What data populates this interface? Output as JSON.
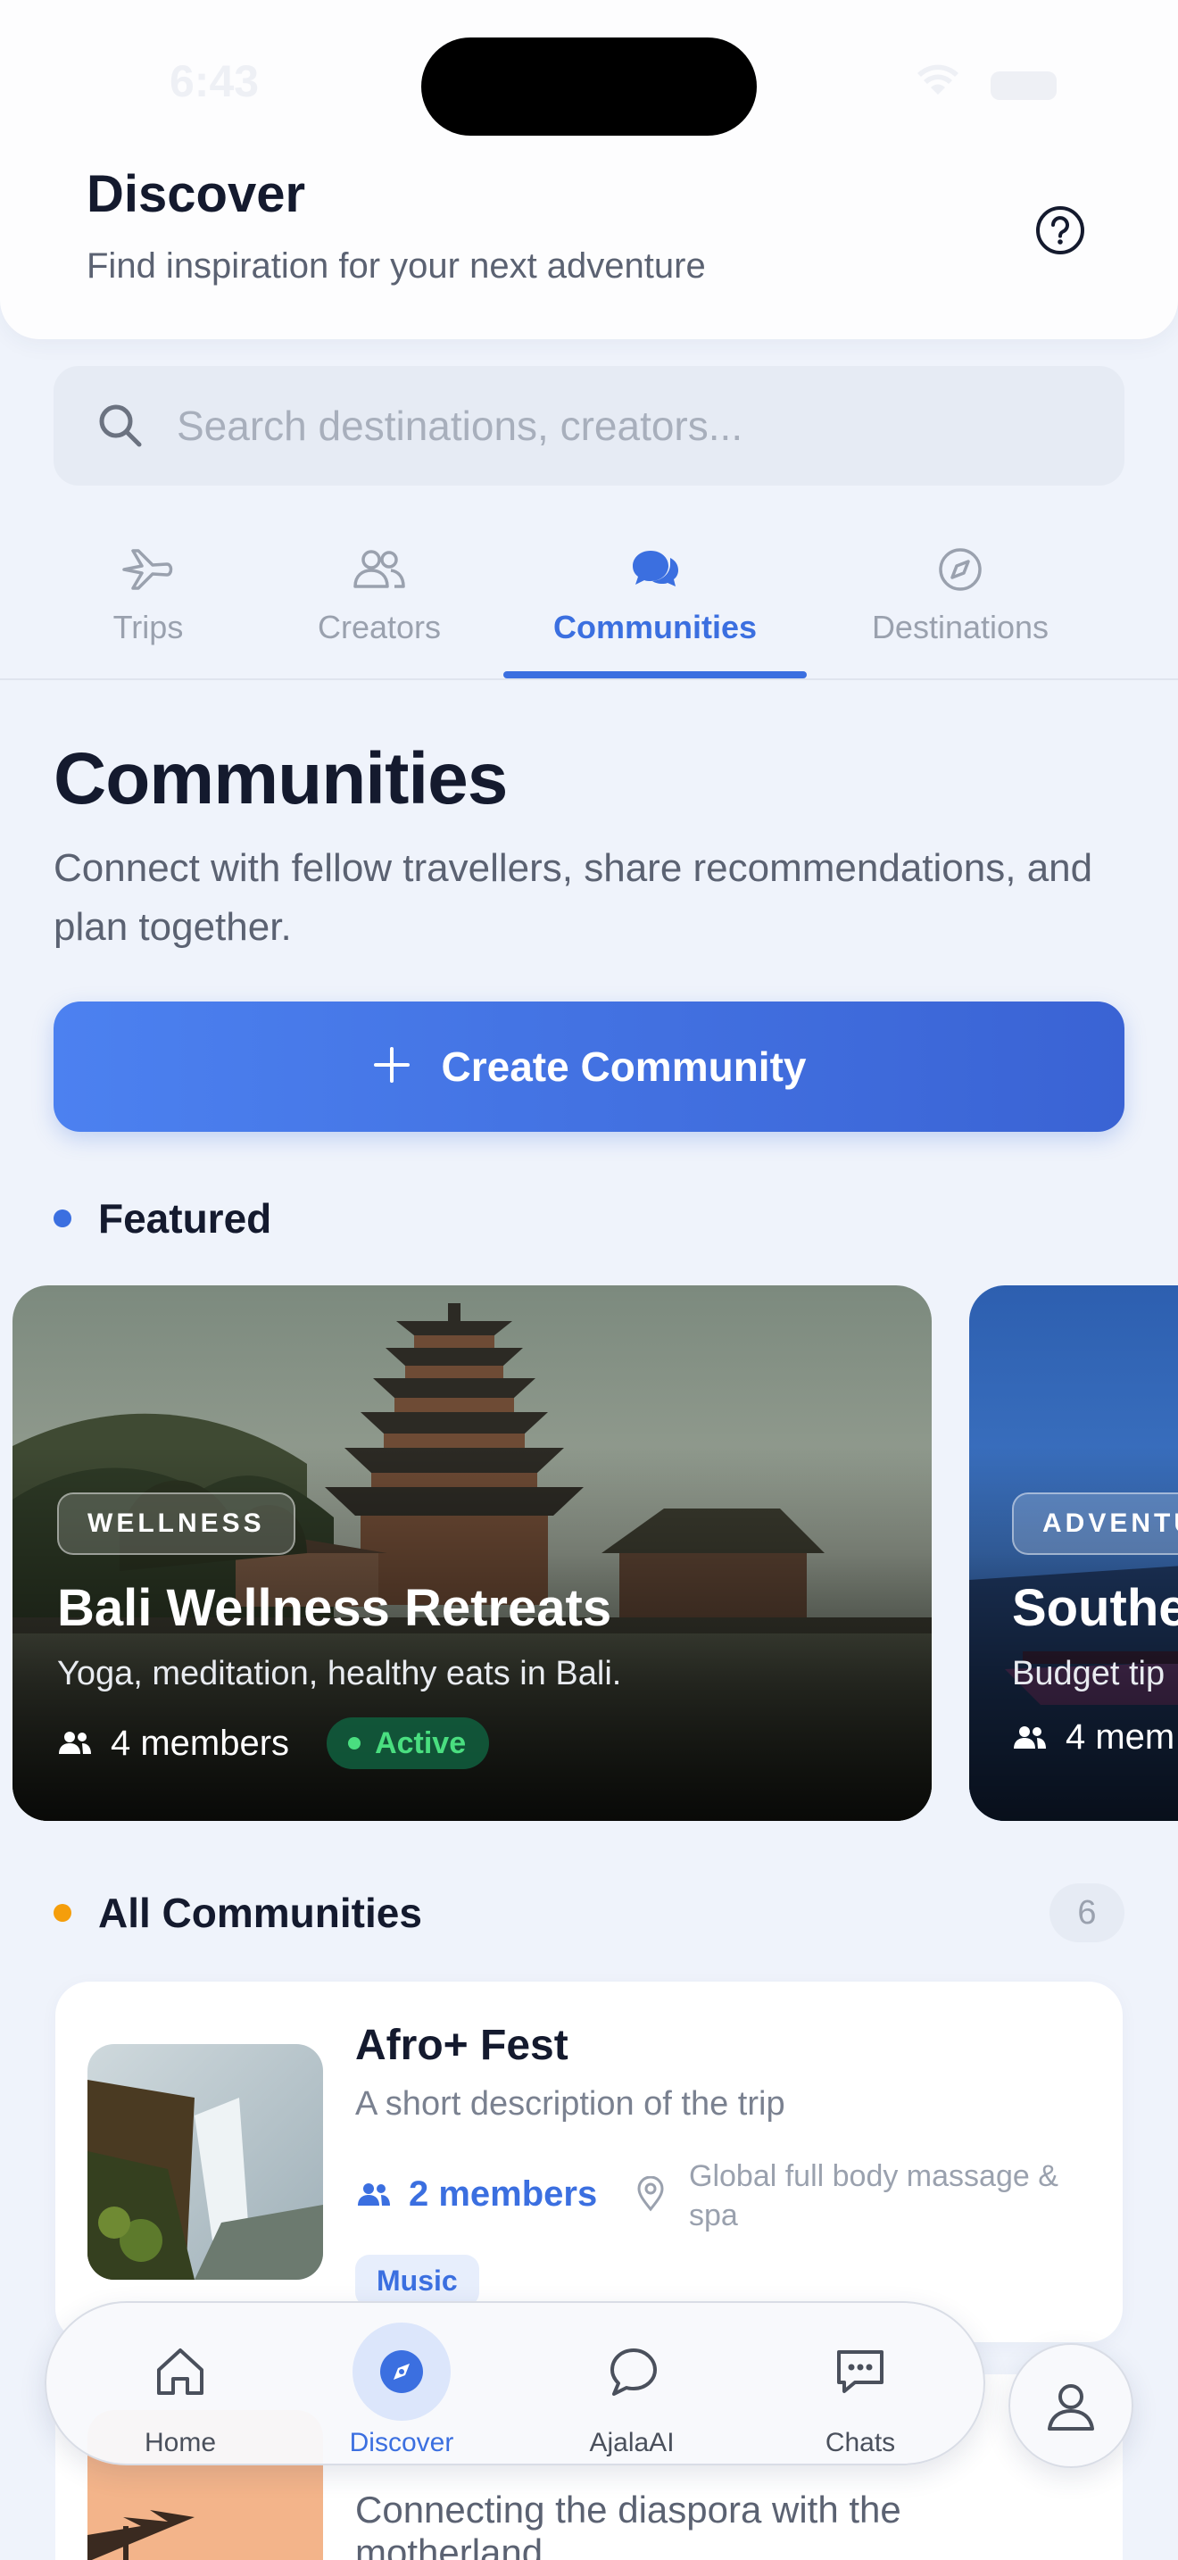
{
  "status_bar": {
    "time": "6:43"
  },
  "header": {
    "title": "Discover",
    "subtitle": "Find inspiration for your next adventure",
    "help_icon": "question-circle-icon"
  },
  "search": {
    "placeholder": "Search destinations, creators...",
    "value": ""
  },
  "tabs": [
    {
      "label": "Trips",
      "icon": "plane-icon",
      "active": false
    },
    {
      "label": "Creators",
      "icon": "users-icon",
      "active": false
    },
    {
      "label": "Communities",
      "icon": "chat-bubbles-icon",
      "active": true
    },
    {
      "label": "Destinations",
      "icon": "compass-icon",
      "active": false
    }
  ],
  "communities": {
    "title": "Communities",
    "description": "Connect with fellow travellers, share recommendations, and plan together.",
    "create_label": "Create Community"
  },
  "featured": {
    "heading": "Featured",
    "accent": "#3b6fe0",
    "cards": [
      {
        "category": "WELLNESS",
        "title": "Bali Wellness Retreats",
        "description": "Yoga, meditation, healthy eats in Bali.",
        "members": "4 members",
        "status": "Active"
      },
      {
        "category": "ADVENTU",
        "title": "Southe",
        "description": "Budget tip",
        "members": "4 mem"
      }
    ]
  },
  "all_communities": {
    "heading": "All Communities",
    "accent": "#f59e0b",
    "count": "6",
    "items": [
      {
        "title": "Afro+ Fest",
        "description": "A short description of the trip",
        "members": "2 members",
        "location": "Global full body massage & spa",
        "tag": "Music"
      },
      {
        "description": "Connecting the diaspora with the motherland"
      }
    ]
  },
  "bottom_nav": [
    {
      "label": "Home",
      "icon": "home-icon",
      "active": false
    },
    {
      "label": "Discover",
      "icon": "compass-icon",
      "active": true
    },
    {
      "label": "AjalaAI",
      "icon": "chat-bubble-icon",
      "active": false
    },
    {
      "label": "Chats",
      "icon": "message-dots-icon",
      "active": false
    }
  ],
  "colors": {
    "primary": "#3b6fe0",
    "active_green": "#4ade80",
    "background": "#eff3fb"
  }
}
